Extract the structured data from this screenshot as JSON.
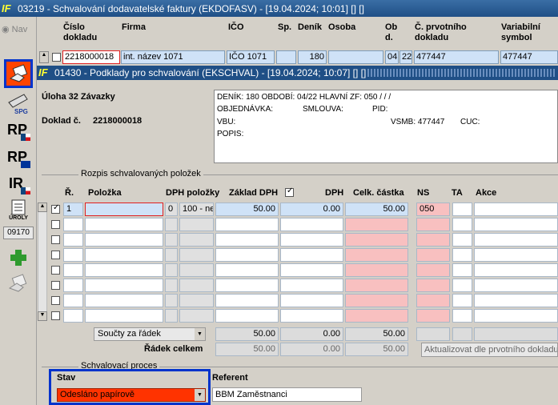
{
  "window": {
    "title": "03219 - Schvalování dodavatelské faktury (EKDOFASV) - [19.04.2024; 10:01] [] []"
  },
  "nav": {
    "label": "Nav"
  },
  "toolbar": {
    "spg": "SPG",
    "rp1": "RP",
    "rp2": "RP",
    "ir": "IR",
    "role": "ÚROLY",
    "code": "09170"
  },
  "outer": {
    "headers": {
      "cislo": "Číslo dokladu",
      "firma": "Firma",
      "ico": "IČO",
      "sp": "Sp.",
      "denik": "Deník",
      "osoba": "Osoba",
      "obd": "Ob d.",
      "cprv": "Č. prvotního dokladu",
      "vs": "Variabilní symbol"
    },
    "row": {
      "cislo": "2218000018",
      "firma": "int. název 1071",
      "ico": "IČO 1071",
      "sp": "",
      "denik": "180",
      "osoba": "",
      "ob": "04",
      "d": "22",
      "cprv": "477447",
      "vs": "477447"
    }
  },
  "inner": {
    "title": "01430 - Podklady pro schvalování (EKSCHVAL) - [19.04.2024; 10:07] [] []",
    "uloha": "Úloha 32 Závazky",
    "doklad_label": "Doklad č.",
    "doklad_value": "2218000018",
    "info": {
      "line1": "DENÍK: 180   OBDOBÍ: 04/22   HLAVNÍ ZF: 050 /  /  /",
      "obj": "OBJEDNÁVKA:",
      "smlouva": "SMLOUVA:",
      "pid": "PID:",
      "vbu": "VBU:",
      "vsmb": "VSMB: 477447",
      "cuc": "CUC:",
      "popis": "POPIS:"
    },
    "section_label": "Rozpis schvalovaných položek",
    "grid_headers": {
      "r": "Ř.",
      "polozka": "Položka",
      "dph": "DPH položky",
      "zaklad": "Základ DPH",
      "dph2": "DPH",
      "celk": "Celk. částka",
      "ns": "NS",
      "ta": "TA",
      "akce": "Akce"
    },
    "row1": {
      "r": "1",
      "polozka": "",
      "dph_n": "0",
      "dph_txt": "100 - ne",
      "zaklad": "50.00",
      "dph": "0.00",
      "celk": "50.00",
      "ns": "050"
    },
    "soucty": {
      "select": "Součty za řádek",
      "zaklad": "50.00",
      "dph": "0.00",
      "celk": "50.00"
    },
    "radek": {
      "label": "Řádek celkem",
      "zaklad": "50.00",
      "dph": "0.00",
      "celk": "50.00"
    },
    "aktualizovat": "Aktualizovat dle prvotního dokladu",
    "proces_label": "Schvalovací proces",
    "stav_label": "Stav",
    "stav_value": "Odesláno papírově",
    "referent_label": "Referent",
    "referent_value": "BBM Zaměstnanci"
  },
  "colors": {
    "accent_blue": "#1f4f86",
    "highlight_box": "#0033cc",
    "status_red": "#ff3300",
    "ns_pink": "#f8c0c0"
  }
}
